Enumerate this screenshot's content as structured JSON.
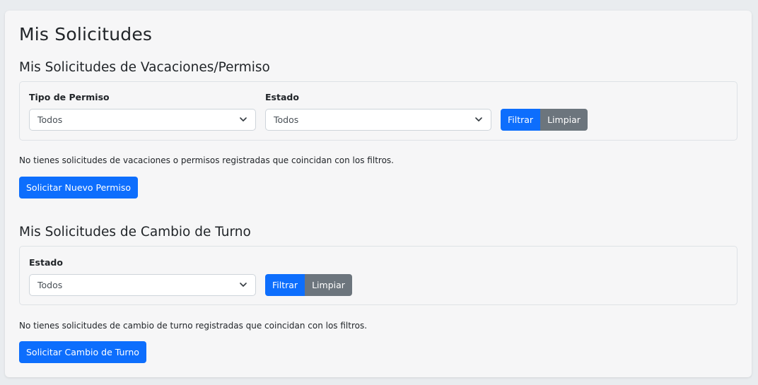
{
  "page_title": "Mis Solicitudes",
  "vacaciones": {
    "title": "Mis Solicitudes de Vacaciones/Permiso",
    "tipo_label": "Tipo de Permiso",
    "tipo_value": "Todos",
    "estado_label": "Estado",
    "estado_value": "Todos",
    "filter_label": "Filtrar",
    "clear_label": "Limpiar",
    "empty_message": "No tienes solicitudes de vacaciones o permisos registradas que coincidan con los filtros.",
    "new_label": "Solicitar Nuevo Permiso"
  },
  "turno": {
    "title": "Mis Solicitudes de Cambio de Turno",
    "estado_label": "Estado",
    "estado_value": "Todos",
    "filter_label": "Filtrar",
    "clear_label": "Limpiar",
    "empty_message": "No tienes solicitudes de cambio de turno registradas que coincidan con los filtros.",
    "new_label": "Solicitar Cambio de Turno"
  },
  "colors": {
    "primary": "#0d6efd",
    "secondary": "#6c757d"
  },
  "icons": {
    "select_arrow": "chevron-down-icon"
  }
}
